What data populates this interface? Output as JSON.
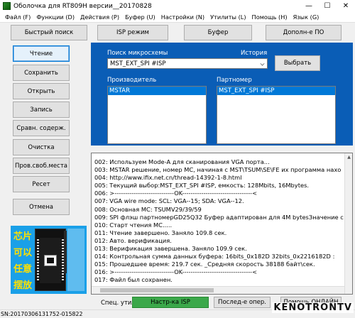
{
  "window": {
    "title": "Оболочка для RT809H версии__20170828",
    "minimize": "—",
    "maximize": "☐",
    "close": "✕"
  },
  "menu": [
    "Файл (F)",
    "Функции (D)",
    "Действия (P)",
    "Буфер (U)",
    "Настройки (N)",
    "Утилиты (L)",
    "Помощь (H)",
    "Язык (G)"
  ],
  "toolbar": {
    "quick_search": "Быстрый поиск",
    "isp_mode": "ISP режим",
    "buffer": "Буфер",
    "extra": "Дополн-е ПО"
  },
  "sidebar": {
    "items": [
      "Чтение",
      "Сохранить",
      "Открыть",
      "Запись",
      "Сравн. содерж.",
      "Очистка",
      "Пров.своб.места",
      "Ресет"
    ],
    "cancel": "Отмена"
  },
  "chip_search": {
    "label": "Поиск микросхемы",
    "history_label": "История",
    "value": "MST_EXT_SPI #ISP",
    "select_button": "Выбрать"
  },
  "manufacturer": {
    "label": "Производитель",
    "selected": "MSTAR"
  },
  "part_number": {
    "label": "Партномер",
    "selected": "MST_EXT_SPI #ISP"
  },
  "log": [
    "002: Используем Mode-A для сканирования VGA порта...",
    "003:  MSTAR решение, номер МС, начиная с MST\\TSUM\\SE\\FE их программа нахо",
    "004: http://www.ifix.net.cn/thread-14392-1-8.html",
    "005: Текущий выбор:MST_EXT_SPI #ISP, емкость: 128Mbits, 16Mbytes.",
    "006: >----------------------------OK---------------------------------<",
    "007: VGA wire mode: SCL: VGA--15; SDA: VGA--12.",
    "008: Основная МС: TSUMV29/39/59",
    "009: SPI флэш партномерGD25Q32 Буфер адаптирован для 4M bytesЗначение с",
    "010: Старт чтения МС.....",
    "011: Чтение завершено. Заняло 109.8 сек.",
    "012: Авто. верификация.",
    "013: Верификация завершена. Заняло 109.9 сек.",
    "014: Контрольная сумма данных буфера: 16bits_0x182D  32bits_0x2216182D :",
    "015: Прошедшее время: 219.7 сек. _Средняя скорость 38188 байт\\сек.",
    "016: >----------------------------OK---------------------------------<",
    "017: Файл был сохранен."
  ],
  "zif_label": [
    "芯片",
    "可以",
    "任意",
    "摆放"
  ],
  "bottom": {
    "special_util_label": "Спец. утил.",
    "isp_settings": "Настр-ка ISP",
    "last_op": "Послед-е опер.",
    "help_online": "Помощь ОНЛАЙН"
  },
  "status": {
    "sn": "SN:20170306131752-015822"
  },
  "watermark": "KENOTRONTV"
}
